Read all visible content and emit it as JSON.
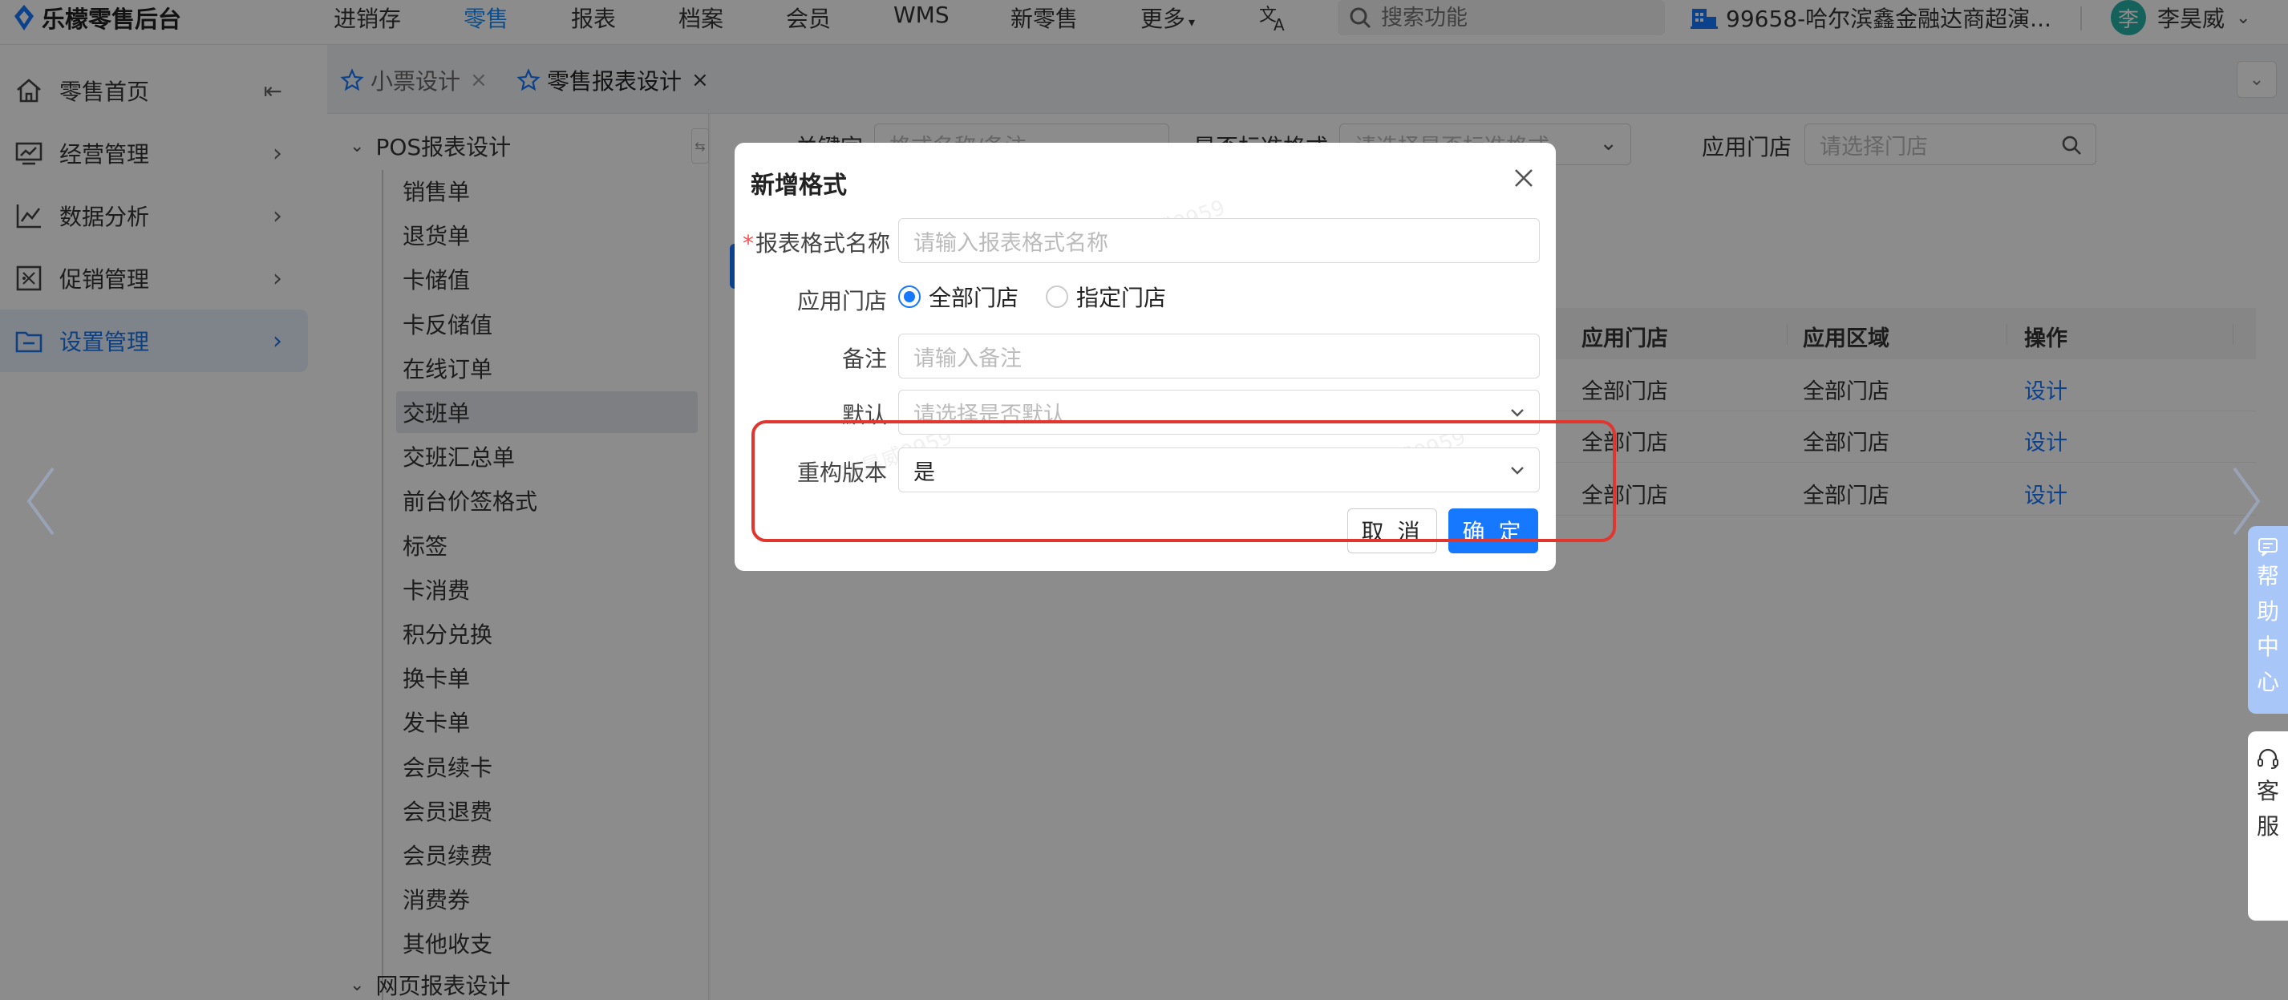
{
  "app": {
    "name": "乐檬零售后台"
  },
  "topnav": {
    "items": [
      "进销存",
      "零售",
      "报表",
      "档案",
      "会员",
      "WMS",
      "新零售",
      "更多"
    ],
    "active": "零售"
  },
  "search": {
    "placeholder": "搜索功能"
  },
  "store": {
    "name": "99658-哈尔滨鑫金融达商超演..."
  },
  "user": {
    "avatar_char": "李",
    "name": "李昊威"
  },
  "sidebar": {
    "items": [
      {
        "label": "零售首页",
        "icon": "home-icon"
      },
      {
        "label": "经营管理",
        "icon": "monitor-icon"
      },
      {
        "label": "数据分析",
        "icon": "line-chart-icon"
      },
      {
        "label": "促销管理",
        "icon": "promotion-icon"
      },
      {
        "label": "设置管理",
        "icon": "settings-folder-icon"
      }
    ],
    "active": "设置管理"
  },
  "tabs": [
    {
      "label": "小票设计",
      "active": false
    },
    {
      "label": "零售报表设计",
      "active": true
    }
  ],
  "tree": {
    "groups": [
      {
        "label": "POS报表设计"
      },
      {
        "label": "网页报表设计"
      }
    ],
    "leaves": [
      "销售单",
      "退货单",
      "卡储值",
      "卡反储值",
      "在线订单",
      "交班单",
      "交班汇总单",
      "前台价签格式",
      "标签",
      "卡消费",
      "积分兑换",
      "换卡单",
      "发卡单",
      "会员续卡",
      "会员退费",
      "会员续费",
      "消费券",
      "其他收支"
    ],
    "active": "交班单"
  },
  "filters": {
    "keyword_label": "关键字",
    "keyword_placeholder": "格式名称/备注",
    "standard_label": "是否标准格式",
    "standard_placeholder": "请选择是否标准格式",
    "store_label": "应用门店",
    "store_placeholder": "请选择门店"
  },
  "table": {
    "headers": [
      "应用门店",
      "应用区域",
      "操作"
    ],
    "rows": [
      [
        "全部门店",
        "全部门店",
        "设计"
      ],
      [
        "全部门店",
        "全部门店",
        "设计"
      ],
      [
        "全部门店",
        "全部门店",
        "设计"
      ]
    ]
  },
  "modal": {
    "title": "新增格式",
    "fields": {
      "name_label": "报表格式名称",
      "name_required_mark": "*",
      "name_placeholder": "请输入报表格式名称",
      "store_label": "应用门店",
      "store_options": [
        "全部门店",
        "指定门店"
      ],
      "store_selected": "全部门店",
      "remark_label": "备注",
      "remark_placeholder": "请输入备注",
      "default_label": "默认",
      "default_placeholder": "请选择是否默认",
      "refactor_label": "重构版本",
      "refactor_value": "是"
    },
    "cancel_label": "取 消",
    "ok_label": "确 定",
    "watermark": "李昊威9959"
  },
  "float": {
    "help_chars": [
      "帮",
      "助",
      "中",
      "心"
    ],
    "service_chars": [
      "客",
      "服"
    ]
  },
  "colors": {
    "accent": "#1677ff",
    "highlight": "#e0362e",
    "avatar_bg": "#26b3a6"
  }
}
